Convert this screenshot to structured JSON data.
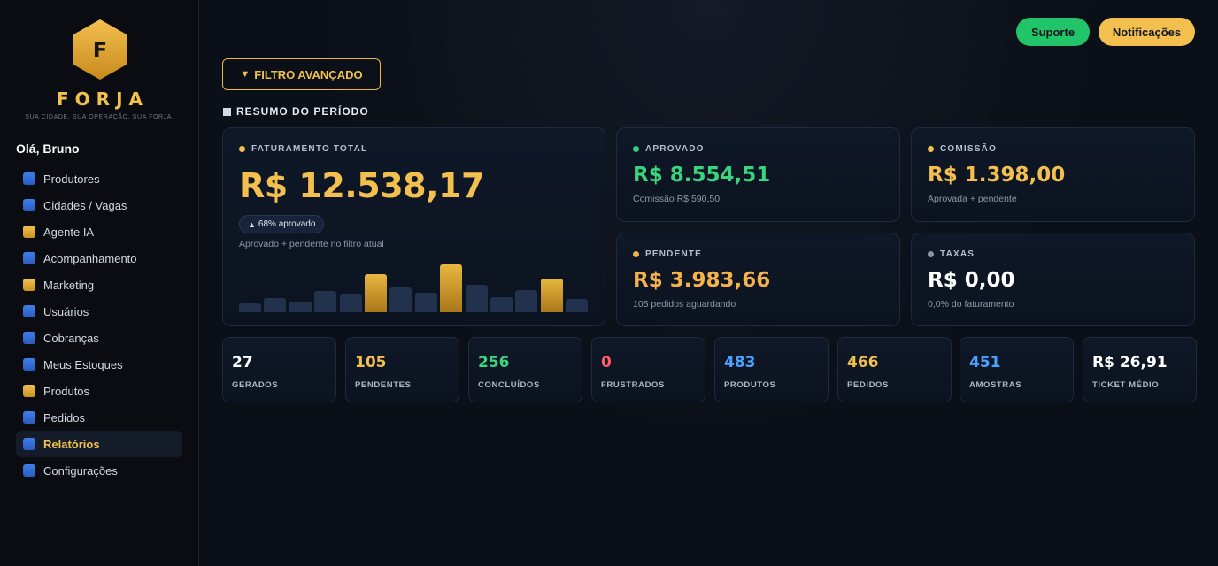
{
  "brand": {
    "logo_letter": "F",
    "name": "FORJA",
    "tagline": "SUA CIDADE. SUA OPERAÇÃO. SUA FORJA."
  },
  "user": {
    "greeting": "Olá, Bruno"
  },
  "sidebar": {
    "items": [
      {
        "label": "Produtores",
        "icon": "blue-square-icon"
      },
      {
        "label": "Cidades / Vagas",
        "icon": "blue-square-icon"
      },
      {
        "label": "Agente IA",
        "icon": "gold-square-icon"
      },
      {
        "label": "Acompanhamento",
        "icon": "blue-square-icon"
      },
      {
        "label": "Marketing",
        "icon": "gold-square-icon"
      },
      {
        "label": "Usuários",
        "icon": "blue-square-icon"
      },
      {
        "label": "Cobranças",
        "icon": "blue-square-icon"
      },
      {
        "label": "Meus Estoques",
        "icon": "blue-square-icon"
      },
      {
        "label": "Produtos",
        "icon": "gold-square-icon"
      },
      {
        "label": "Pedidos",
        "icon": "blue-square-icon"
      },
      {
        "label": "Relatórios",
        "icon": "blue-square-icon",
        "active": true
      },
      {
        "label": "Configurações",
        "icon": "blue-square-icon"
      }
    ]
  },
  "header": {
    "support_label": "Suporte",
    "notifications_label": "Notificações"
  },
  "filter": {
    "label": "FILTRO AVANÇADO",
    "icon": "triangle-down-icon"
  },
  "summary": {
    "title": "RESUMO DO PERÍODO",
    "total": {
      "label": "FATURAMENTO TOTAL",
      "value": "R$ 12.538,17",
      "badge": "68% aprovado",
      "note": "Aprovado + pendente no filtro atual",
      "bars": [
        {
          "value": 0.17,
          "highlight": false
        },
        {
          "value": 0.28,
          "highlight": false
        },
        {
          "value": 0.21,
          "highlight": false
        },
        {
          "value": 0.43,
          "highlight": false
        },
        {
          "value": 0.35,
          "highlight": false
        },
        {
          "value": 0.76,
          "highlight": true
        },
        {
          "value": 0.5,
          "highlight": false
        },
        {
          "value": 0.39,
          "highlight": false
        },
        {
          "value": 0.96,
          "highlight": true
        },
        {
          "value": 0.56,
          "highlight": false
        },
        {
          "value": 0.31,
          "highlight": false
        },
        {
          "value": 0.44,
          "highlight": false
        },
        {
          "value": 0.67,
          "highlight": true
        },
        {
          "value": 0.26,
          "highlight": false
        }
      ]
    },
    "aprovado": {
      "label": "APROVADO",
      "value": "R$ 8.554,51",
      "note": "Comissão R$ 590,50"
    },
    "comissao": {
      "label": "COMISSÃO",
      "value": "R$ 1.398,00",
      "note": "Aprovada + pendente"
    },
    "pendente": {
      "label": "PENDENTE",
      "value": "R$ 3.983,66",
      "note": "105 pedidos aguardando"
    },
    "taxas": {
      "label": "TAXAS",
      "value": "R$ 0,00",
      "note": "0,0% do faturamento"
    }
  },
  "stats": [
    {
      "value": "27",
      "label": "GERADOS",
      "color": "#ffffff"
    },
    {
      "value": "105",
      "label": "PENDENTES",
      "color": "#f3c04f"
    },
    {
      "value": "256",
      "label": "CONCLUÍDOS",
      "color": "#3ad47f"
    },
    {
      "value": "0",
      "label": "FRUSTRADOS",
      "color": "#ff5c6c"
    },
    {
      "value": "483",
      "label": "PRODUTOS",
      "color": "#4aa3ff"
    },
    {
      "value": "466",
      "label": "PEDIDOS",
      "color": "#f3c04f"
    },
    {
      "value": "451",
      "label": "AMOSTRAS",
      "color": "#4aa3ff"
    },
    {
      "value": "R$ 26,91",
      "label": "TICKET MÉDIO",
      "color": "#ffffff"
    }
  ],
  "colors": {
    "accent_gold": "#f3c04f",
    "accent_green": "#22c46a",
    "background": "#0b0f17"
  }
}
